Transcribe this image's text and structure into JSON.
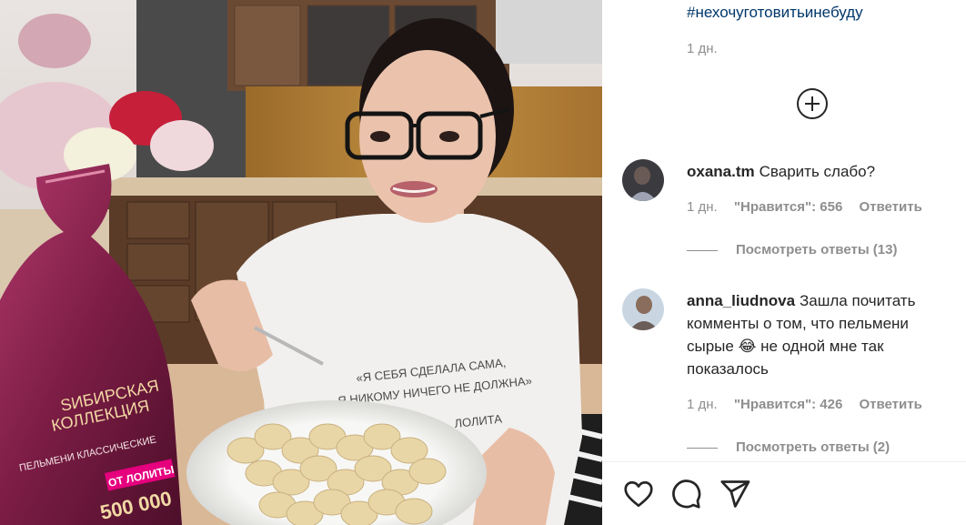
{
  "caption": {
    "hashtag": "#нехочуготовитьинебуду",
    "time": "1 дн."
  },
  "load_more_icon": "plus-circle-icon",
  "comments": [
    {
      "username": "oxana.tm",
      "text": "Сварить слабо?",
      "time": "1 дн.",
      "likes": "\"Нравится\": 656",
      "reply": "Ответить",
      "view_replies": "Посмотреть ответы (13)"
    },
    {
      "username": "anna_liudnova",
      "text": "Зашла почитать комменты о том, что пельмени сырые 😂 не одной мне так показалось",
      "time": "1 дн.",
      "likes": "\"Нравится\": 426",
      "reply": "Ответить",
      "view_replies": "Посмотреть ответы (2)"
    }
  ],
  "photo": {
    "package_brand": "SИБИРСКАЯ КОЛЛЕКЦИЯ",
    "package_brand_line1": "SИБИРСКАЯ",
    "package_brand_line2": "КОЛЛЕКЦИЯ",
    "package_type": "ПЕЛЬМЕНИ КЛАССИЧЕСКИЕ",
    "package_promo": "ОТ ЛОЛИТЫ",
    "package_amount": "500 000",
    "shirt_line1": "«Я СЕБЯ СДЕЛАЛА САМА,",
    "shirt_line2": "Я НИКОМУ НИЧЕГО НЕ ДОЛЖНА»",
    "shirt_line3": "ЛОЛИТА"
  },
  "actions": {
    "like_icon": "heart-icon",
    "comment_icon": "comment-bubble-icon",
    "share_icon": "paper-plane-icon"
  },
  "colors": {
    "link": "#00376b",
    "muted": "#8e8e8e",
    "text": "#262626"
  }
}
